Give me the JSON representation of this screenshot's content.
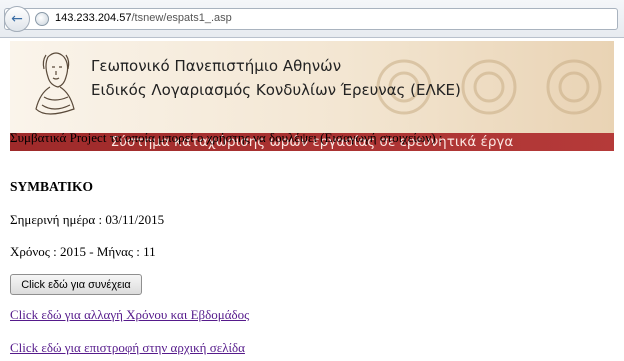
{
  "browser": {
    "url_host": "143.233.204.57",
    "url_path": "/tsnew/espats1_.asp"
  },
  "banner": {
    "title_line1": "Γεωπονικό Πανεπιστήμιο Αθηνών",
    "title_line2": "Ειδικός Λογαριασμός Κονδυλίων Έρευνας (ΕΛΚΕ)",
    "subtitle": "Σύστημα καταχώρισης ωρών εργασίας σε ερευνητικά έργα"
  },
  "content": {
    "intro": "Συμβατικά Project τα οποία μπορεί ο χρήστης να δουλέψει (Εισαγωγή στοιχείων) :",
    "project_name": "SYMBATIKO",
    "date_line": "Σημερινή ημέρα : 03/11/2015",
    "year_month": "Χρόνος : 2015 - Μήνας : 11",
    "continue_button": "Click εδώ για συνέχεια",
    "link_change": "Click εδώ για αλλαγή Χρόνου και Εβδομάδος",
    "link_home": "Click εδώ για επιστροφή στην αρχική σελίδα"
  },
  "colors": {
    "banner_bar": "#b03534",
    "link": "#551a8b"
  },
  "icons": [
    "back-arrow-icon",
    "globe-icon",
    "university-logo"
  ]
}
